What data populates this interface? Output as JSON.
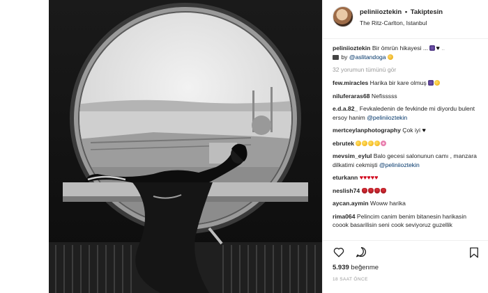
{
  "header": {
    "username": "peliniioztekin",
    "separator": "•",
    "follow_label": "Takiptesin",
    "location": "The Ritz-Carlton, Istanbul"
  },
  "caption": {
    "username": "peliniioztekin",
    "text": "Bir ömrün hikayesi ...",
    "by_label": "by",
    "mention": "@aslitandoga"
  },
  "load_more": "32 yorumun tümünü gör",
  "comments": [
    {
      "user": "few.miracles",
      "text": "Harika bir kare olmuş"
    },
    {
      "user": "niluferaras68",
      "text": "Nefisssss"
    },
    {
      "user": "e.d.a.82_",
      "text": "Fevkaledenin de fevkinde mi diyordu bulent ersoy hanim",
      "mention": "@peliniioztekin"
    },
    {
      "user": "mertceylanphotography",
      "text": "Çok iyi"
    },
    {
      "user": "ebrutek",
      "text": ""
    },
    {
      "user": "mevsim_eylul",
      "text": "Balo gecesi salonunun camı , manzara dilkatimi cekmişti",
      "mention": "@peliniioztekin"
    },
    {
      "user": "eturkann",
      "text": ""
    },
    {
      "user": "neslish74",
      "text": ""
    },
    {
      "user": "aycan.aymin",
      "text": "Woww harika"
    },
    {
      "user": "rima064",
      "text": "Pelincim canim benim bitanesin harikasin coook basarilisin seni cook seviyoruz guzellik"
    }
  ],
  "actions": {
    "likes_count": "5.939",
    "likes_label": "beğenme",
    "timestamp": "18 SAAT ÖNCE"
  },
  "icons": {
    "like": "heart-icon",
    "comment": "comment-bubble-icon",
    "bookmark": "bookmark-icon"
  }
}
